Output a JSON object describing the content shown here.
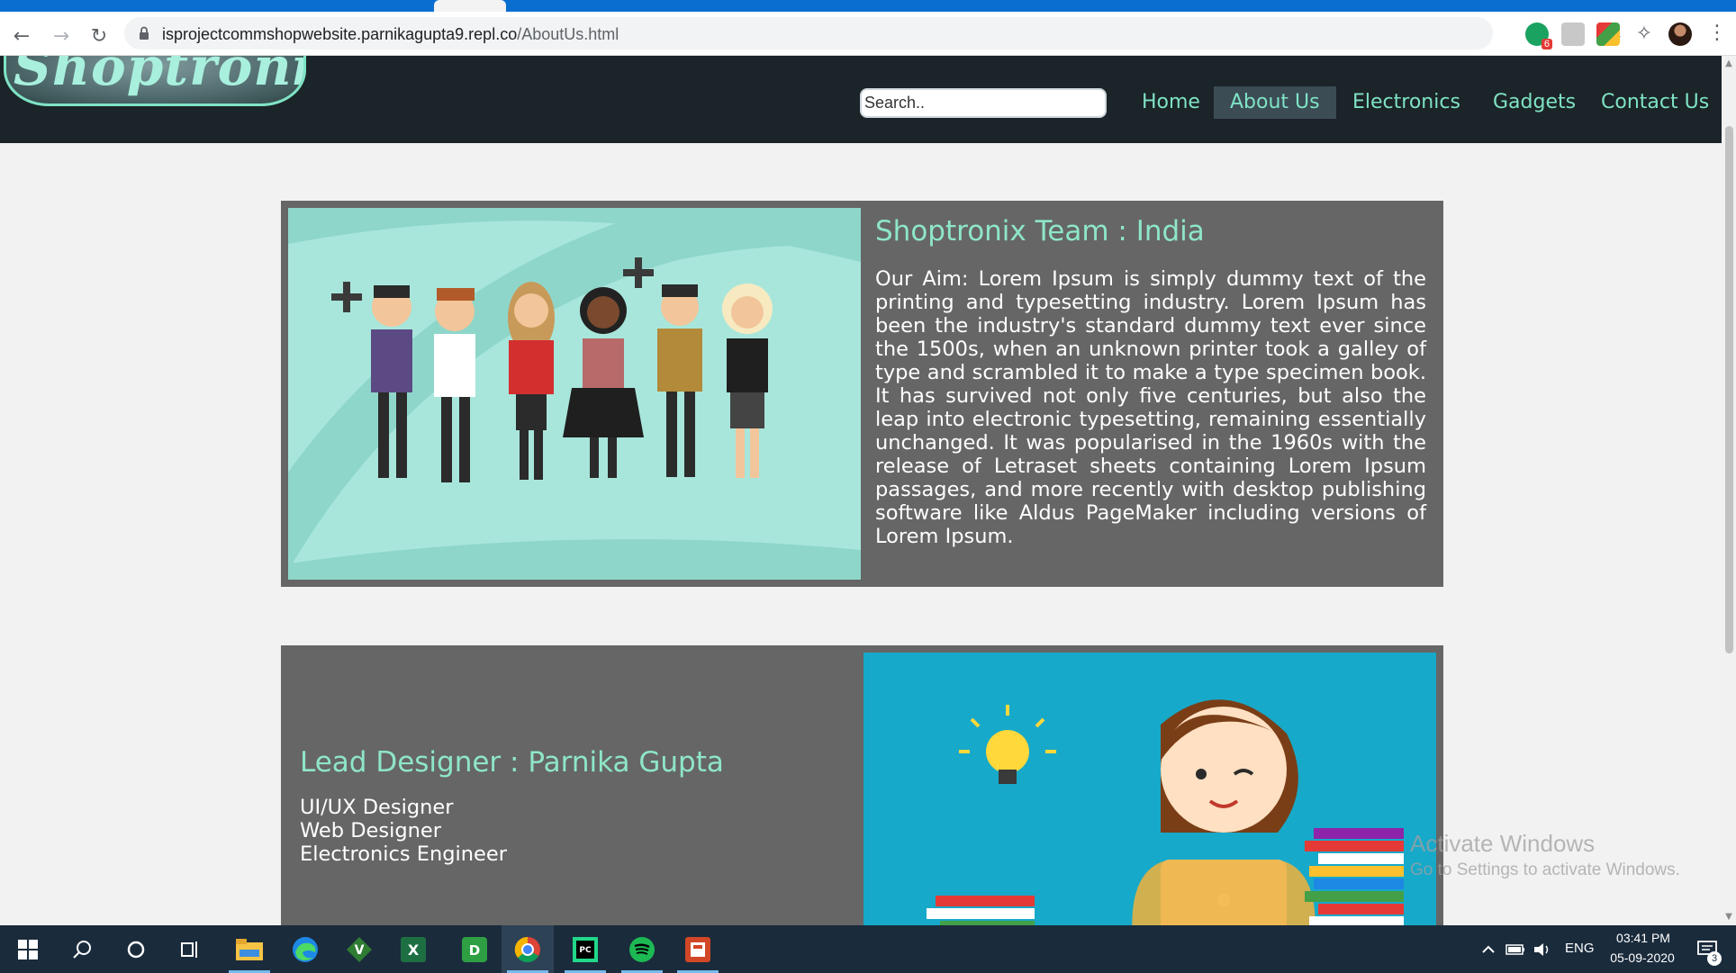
{
  "browser": {
    "url_host": "isprojectcommshopwebsite.parnikagupta9.repl.co",
    "url_path": "/AboutUs.html",
    "extension_badge": "6"
  },
  "site": {
    "logo_text": "Shoptronix",
    "search_placeholder": "Search..",
    "nav": [
      {
        "label": "Home"
      },
      {
        "label": "About Us"
      },
      {
        "label": "Electronics"
      },
      {
        "label": "Gadgets"
      },
      {
        "label": "Contact Us"
      }
    ],
    "team_card": {
      "title": "Shoptronix Team : India",
      "text": "Our Aim: Lorem Ipsum is simply dummy text of the printing and typesetting industry. Lorem Ipsum has been the industry's standard dummy text ever since the 1500s, when an unknown printer took a galley of type and scrambled it to make a type specimen book. It has survived not only five centuries, but also the leap into electronic typesetting, remaining essentially unchanged. It was popularised in the 1960s with the release of Letraset sheets containing Lorem Ipsum passages, and more recently with desktop publishing software like Aldus PageMaker including versions of Lorem Ipsum."
    },
    "designer_card": {
      "title": "Lead Designer : Parnika Gupta",
      "roles": [
        "UI/UX Designer",
        "Web Designer",
        "Electronics Engineer"
      ]
    }
  },
  "watermark": {
    "line1": "Activate Windows",
    "line2": "Go to Settings to activate Windows."
  },
  "taskbar": {
    "apps": [
      "windows-start",
      "search",
      "cortana",
      "task-view",
      "file-explorer",
      "edge",
      "vim-editor",
      "excel",
      "d-app",
      "chrome",
      "pycharm",
      "spotify",
      "powerpoint"
    ],
    "language": "ENG",
    "time": "03:41 PM",
    "date": "05-09-2020",
    "notification_count": "3"
  },
  "colors": {
    "accent": "#8ee6c6",
    "header_bg": "#1b2429",
    "card_bg": "#666666",
    "page_bg": "#f2f2f2"
  }
}
